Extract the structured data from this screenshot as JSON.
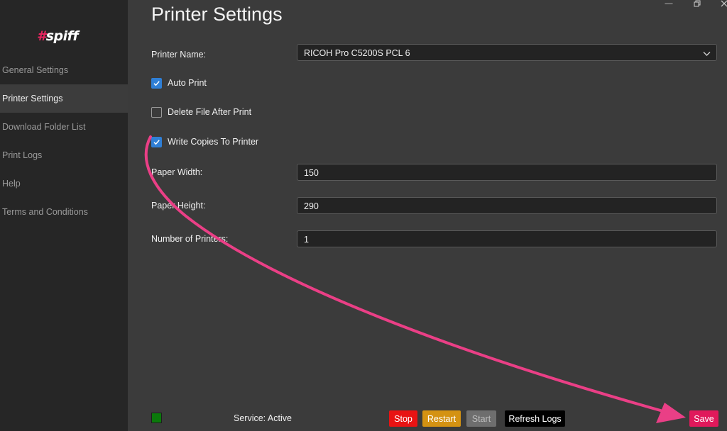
{
  "app": {
    "logo_hash": "#",
    "logo_text": "spiff"
  },
  "sidebar": {
    "items": [
      {
        "label": "General Settings",
        "active": false
      },
      {
        "label": "Printer Settings",
        "active": true
      },
      {
        "label": "Download Folder List",
        "active": false
      },
      {
        "label": "Print Logs",
        "active": false
      },
      {
        "label": "Help",
        "active": false
      },
      {
        "label": "Terms and Conditions",
        "active": false
      }
    ]
  },
  "window": {
    "minimize_icon": "minimize-icon",
    "restore_icon": "restore-icon",
    "close_icon": "close-icon"
  },
  "page": {
    "title": "Printer Settings"
  },
  "printer": {
    "name_label": "Printer Name:",
    "name_value": "RICOH Pro C5200S PCL 6",
    "auto_print": {
      "label": "Auto Print",
      "checked": true
    },
    "delete_file": {
      "label": "Delete File After Print",
      "checked": false
    },
    "write_copies": {
      "label": "Write Copies To Printer",
      "checked": true
    },
    "paper_width": {
      "label": "Paper Width:",
      "value": "150"
    },
    "paper_height": {
      "label": "Paper Height:",
      "value": "290"
    },
    "num_printers": {
      "label": "Number of Printers:",
      "value": "1"
    }
  },
  "footer": {
    "status_text": "Service: Active",
    "status_color": "#0b7a0b",
    "stop_label": "Stop",
    "restart_label": "Restart",
    "start_label": "Start",
    "refresh_label": "Refresh Logs",
    "save_label": "Save"
  },
  "colors": {
    "accent": "#e8245f",
    "checkbox": "#2f7fd6",
    "stop": "#e81313",
    "restart": "#d49212",
    "start_disabled": "#6e6e6e",
    "refresh": "#000000",
    "save": "#e0195b",
    "annotation_arrow": "#ea3f86"
  }
}
